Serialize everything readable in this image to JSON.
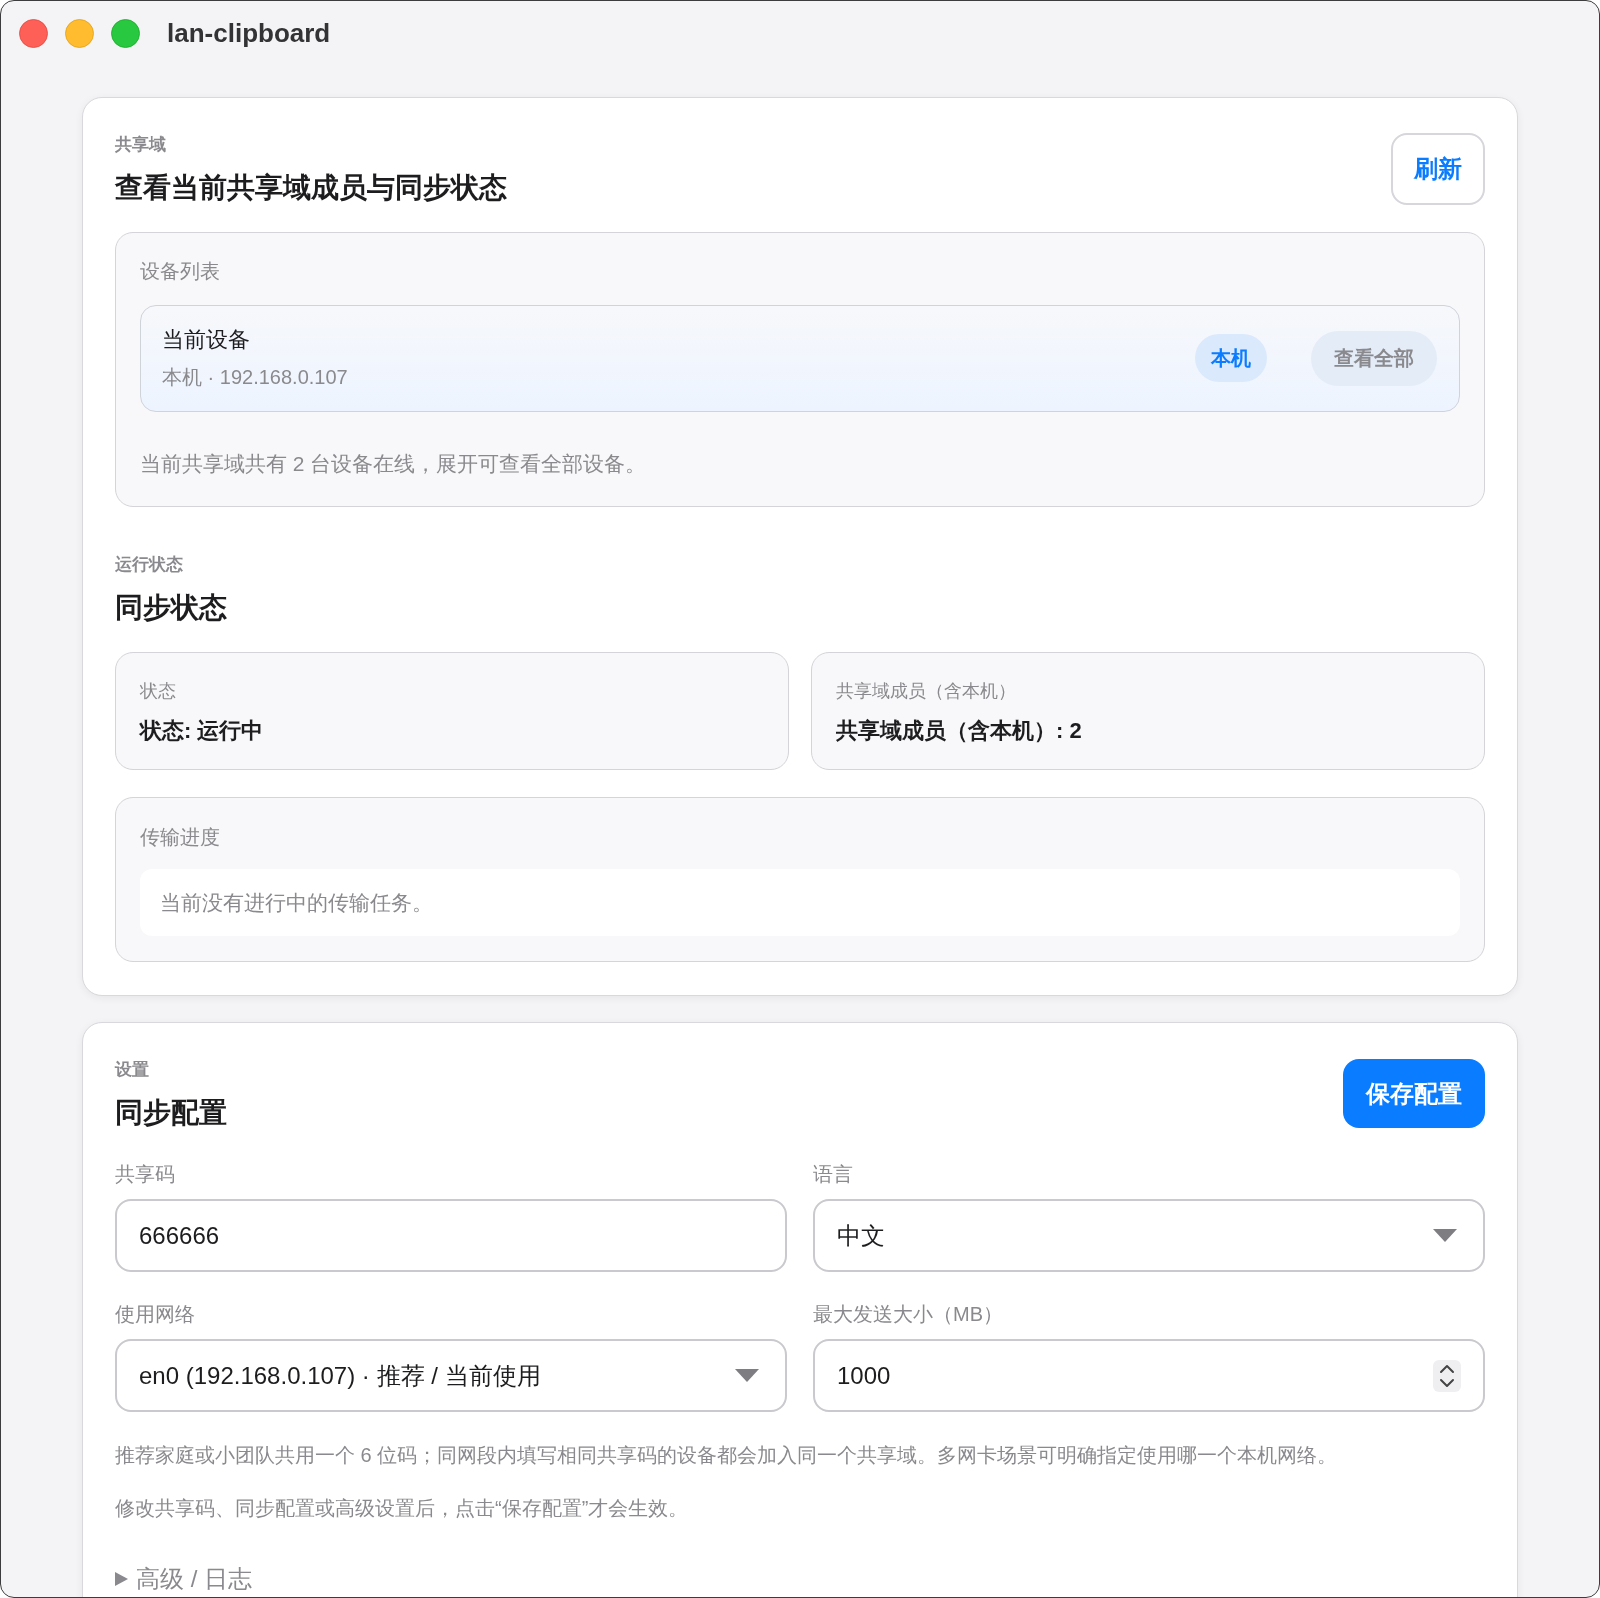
{
  "window": {
    "title": "lan-clipboard"
  },
  "domain_card": {
    "eyebrow": "共享域",
    "title": "查看当前共享域成员与同步状态",
    "refresh_button": "刷新",
    "device_list": {
      "label": "设备列表",
      "devices": [
        {
          "name": "当前设备",
          "detail": "本机 · 192.168.0.107",
          "badge": "本机",
          "action": "查看全部"
        }
      ],
      "summary": "当前共享域共有 2 台设备在线，展开可查看全部设备。"
    }
  },
  "status_section": {
    "eyebrow": "运行状态",
    "title": "同步状态",
    "stats": [
      {
        "label": "状态",
        "value": "状态: 运行中"
      },
      {
        "label": "共享域成员（含本机）",
        "value": "共享域成员（含本机）: 2"
      }
    ],
    "transfer": {
      "label": "传输进度",
      "message": "当前没有进行中的传输任务。"
    }
  },
  "settings_card": {
    "eyebrow": "设置",
    "title": "同步配置",
    "save_button": "保存配置",
    "fields": [
      {
        "kind": "text",
        "label": "共享码",
        "value": "666666"
      },
      {
        "kind": "select",
        "label": "语言",
        "value": "中文"
      },
      {
        "kind": "select",
        "label": "使用网络",
        "value": "en0 (192.168.0.107) · 推荐 / 当前使用"
      },
      {
        "kind": "number",
        "label": "最大发送大小（MB）",
        "value": "1000"
      }
    ],
    "help": [
      "推荐家庭或小团队共用一个 6 位码；同网段内填写相同共享码的设备都会加入同一个共享域。多网卡场景可明确指定使用哪一个本机网络。",
      "修改共享码、同步配置或高级设置后，点击“保存配置”才会生效。"
    ],
    "details": {
      "summary": "高级 / 日志",
      "expanded": false
    }
  }
}
